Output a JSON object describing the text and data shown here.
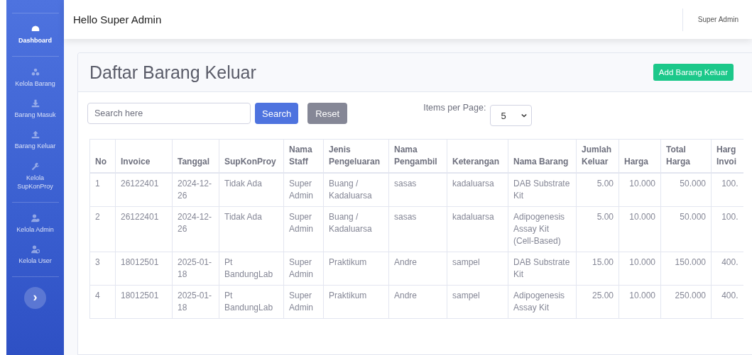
{
  "sidebar": {
    "sections": [
      [
        {
          "label": "Dashboard",
          "kind": "gauge",
          "selected": true
        }
      ],
      [
        {
          "label": "Kelola Barang",
          "kind": "boxes",
          "selected": false
        },
        {
          "label": "Barang Masuk",
          "kind": "download",
          "selected": false
        },
        {
          "label": "Barang Keluar",
          "kind": "upload",
          "selected": false
        },
        {
          "label": "Kelola SupKonProy",
          "kind": "wrench",
          "selected": false
        }
      ],
      [
        {
          "label": "Kelola Admin",
          "kind": "user",
          "selected": false
        },
        {
          "label": "Kelola User",
          "kind": "usergear",
          "selected": false
        }
      ]
    ],
    "toggle": "›"
  },
  "topbar": {
    "greeting": "Hello Super Admin",
    "user": "Super Admin"
  },
  "page": {
    "title": "Daftar Barang Keluar",
    "add_button": "Add Barang Keluar"
  },
  "search": {
    "placeholder": "Search here",
    "search_button": "Search",
    "reset_button": "Reset",
    "per_page_label": "Items per Page:",
    "per_page": "5"
  },
  "table": {
    "columns": [
      "No",
      "Invoice",
      "Tanggal",
      "SupKonProy",
      "Nama Staff",
      "Jenis Pengeluaran",
      "Nama Pengambil",
      "Keterangan",
      "Nama Barang",
      "Jumlah Keluar",
      "Harga",
      "Total Harga",
      "Harg Invoi"
    ],
    "rows": [
      [
        "1",
        "26122401",
        "2024-12-26",
        "Tidak Ada",
        "Super Admin",
        "Buang / Kadaluarsa",
        "sasas",
        "kadaluarsa",
        "DAB Substrate Kit",
        "5.00",
        "10.000",
        "50.000",
        "100."
      ],
      [
        "2",
        "26122401",
        "2024-12-26",
        "Tidak Ada",
        "Super Admin",
        "Buang / Kadaluarsa",
        "sasas",
        "kadaluarsa",
        "Adipogenesis Assay Kit (Cell-Based)",
        "5.00",
        "10.000",
        "50.000",
        "100."
      ],
      [
        "3",
        "18012501",
        "2025-01-18",
        "Pt BandungLab",
        "Super Admin",
        "Praktikum",
        "Andre",
        "sampel",
        "DAB Substrate Kit",
        "15.00",
        "10.000",
        "150.000",
        "400."
      ],
      [
        "4",
        "18012501",
        "2025-01-18",
        "Pt BandungLab",
        "Super Admin",
        "Praktikum",
        "Andre",
        "sampel",
        "Adipogenesis Assay Kit",
        "25.00",
        "10.000",
        "250.000",
        "400."
      ]
    ]
  }
}
